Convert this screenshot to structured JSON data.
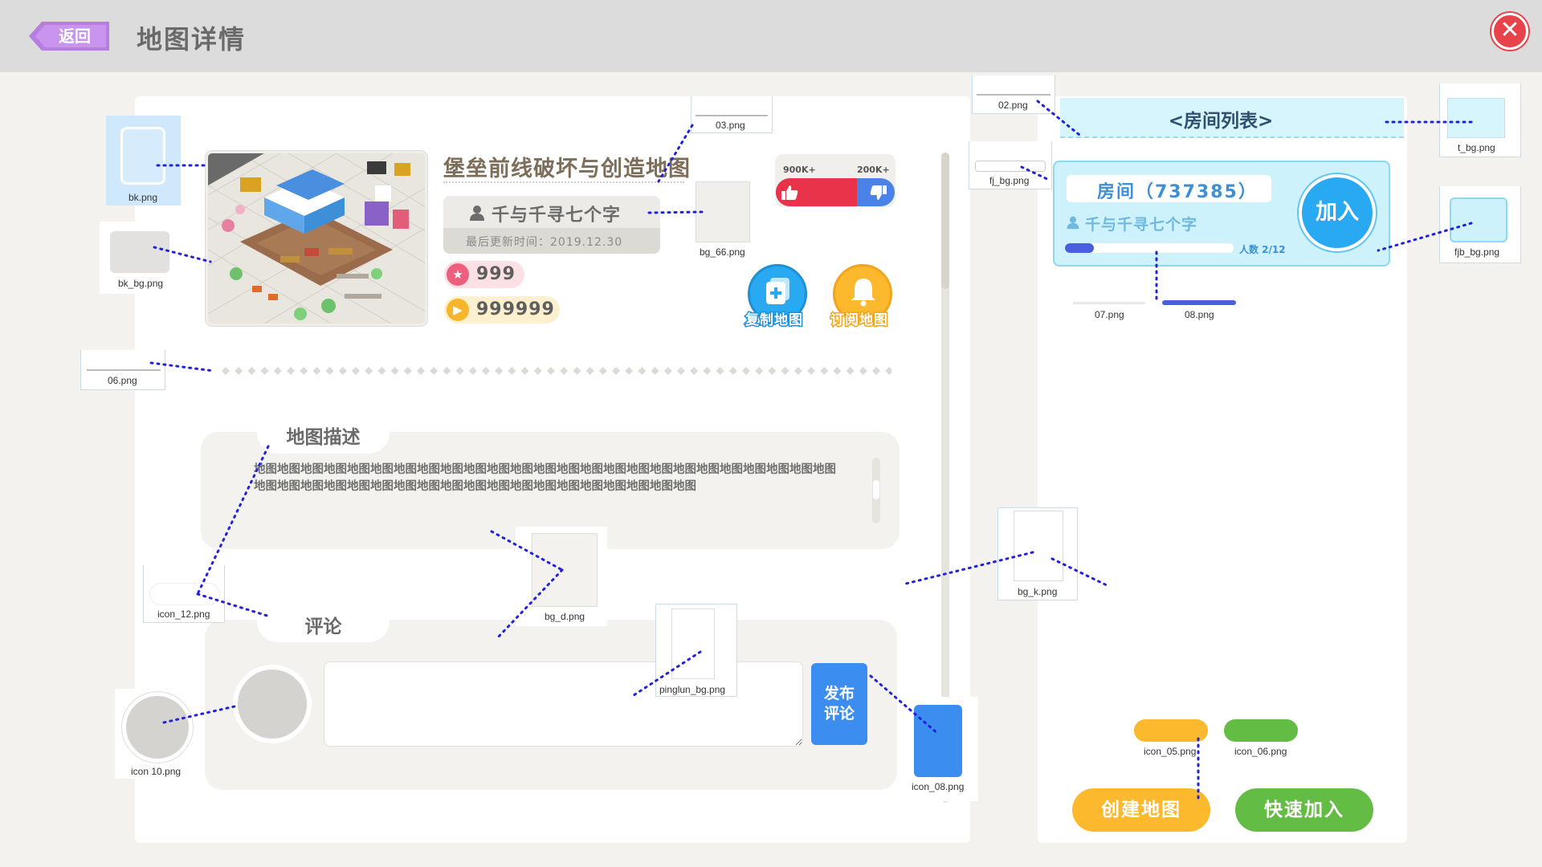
{
  "header": {
    "back_label": "返回",
    "title": "地图详情"
  },
  "map": {
    "name": "堡垒前线破坏与创造地图",
    "author": "千与千寻七个字",
    "updated": "最后更新时间：2019.12.30",
    "stars": "999",
    "plays": "999999",
    "likes": "900K+",
    "dislikes": "200K+",
    "like_ratio": 0.68,
    "copy_label": "复制地图",
    "subscribe_label": "订阅地图"
  },
  "description": {
    "title": "地图描述",
    "text": "地图地图地图地图地图地图地图地图地图地图地图地图地图地图地图地图地图地图地图地图地图地图地图地图地图地图地图地图地图地图地图地图地图地图地图地图地图地图地图地图地图地图地图地图"
  },
  "comment": {
    "title": "评论",
    "input_value": "",
    "submit_label": "发布评论"
  },
  "rooms": {
    "title": "<房间列表>",
    "items": [
      {
        "name": "房间（737385）",
        "owner": "千与千寻七个字",
        "count": "人数 2/12",
        "fill": 0.17,
        "join_label": "加入"
      }
    ]
  },
  "actions": {
    "create_label": "创建地图",
    "quick_join_label": "快速加入"
  },
  "assets": [
    "bk.png",
    "bk_bg.png",
    "03.png",
    "bg_66.png",
    "06.png",
    "icon_12.png",
    "bg_d.png",
    "pinglun_bg.png",
    "icon 10.png",
    "icon_08.png",
    "02.png",
    "fj_bg.png",
    "t_bg.png",
    "fjb_bg.png",
    "07.png",
    "08.png",
    "bg_k.png",
    "icon_05.png",
    "icon_06.png"
  ],
  "colors": {
    "accent_blue": "#3b8ef0",
    "like_red": "#e8334a",
    "close_red": "#e8424a",
    "create_yellow": "#fcb92d",
    "quick_green": "#63bd45",
    "back_purple": "#b87de0"
  }
}
